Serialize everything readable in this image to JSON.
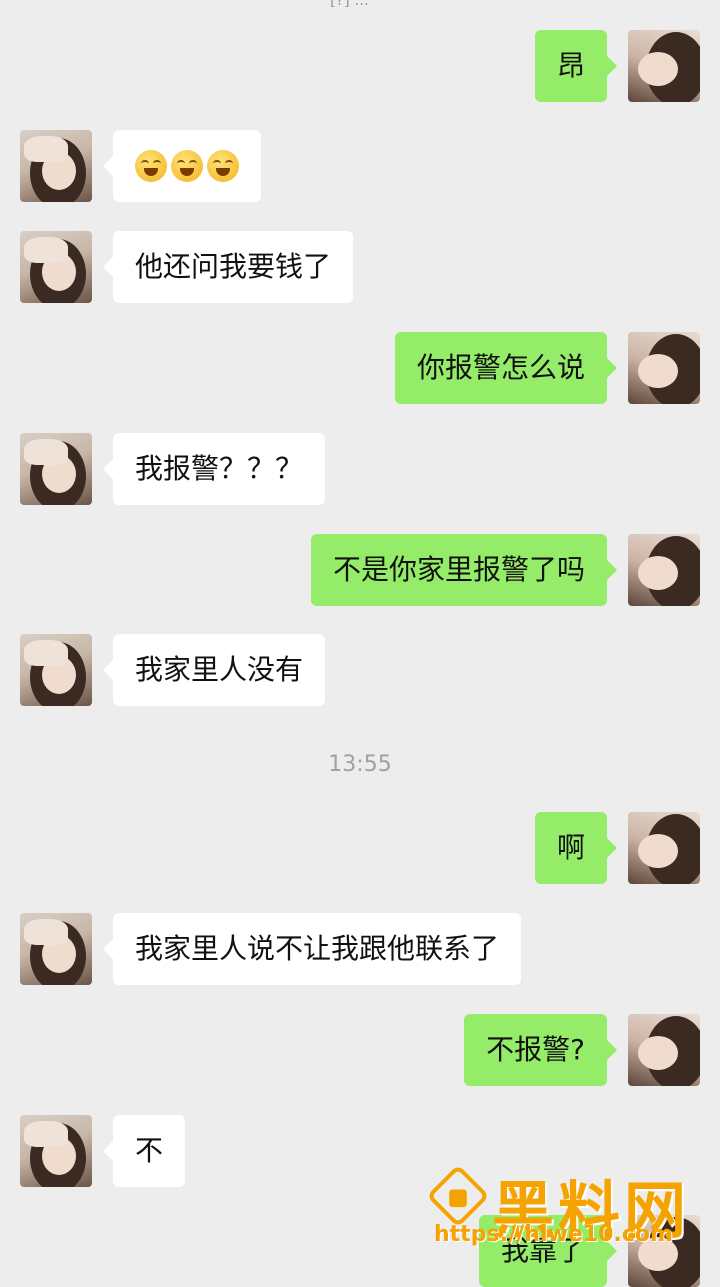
{
  "status": {
    "top_text": "[?] ..."
  },
  "messages": [
    {
      "side": "right",
      "text": "昂"
    },
    {
      "side": "left",
      "emoji": [
        "laughing-crying-emoji",
        "laughing-crying-emoji",
        "laughing-crying-emoji"
      ]
    },
    {
      "side": "left",
      "text": "他还问我要钱了"
    },
    {
      "side": "right",
      "text": "你报警怎么说"
    },
    {
      "side": "left",
      "text": "我报警？？？"
    },
    {
      "side": "right",
      "text": "不是你家里报警了吗"
    },
    {
      "side": "left",
      "text": "我家里人没有"
    },
    {
      "side": "right",
      "text": "啊"
    },
    {
      "side": "left",
      "text": "我家里人说不让我跟他联系了"
    },
    {
      "side": "right",
      "text": "不报警?"
    },
    {
      "side": "left",
      "text": "不"
    },
    {
      "side": "right",
      "text": "我靠了"
    }
  ],
  "timestamp": "13:55",
  "watermark": {
    "title": "黑料网",
    "url": "https://hlwe10.com"
  },
  "colors": {
    "background": "#ededed",
    "bubble_self": "#95ec69",
    "bubble_other": "#ffffff",
    "watermark": "#f5a300"
  }
}
